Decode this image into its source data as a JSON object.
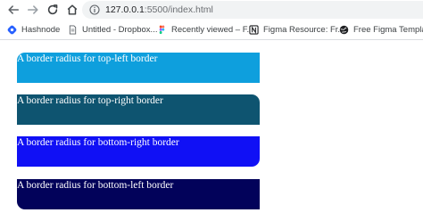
{
  "browser": {
    "url_host": "127.0.0.1",
    "url_rest": ":5500/index.html",
    "bookmarks": [
      {
        "label": "Hashnode",
        "icon": "hashnode-icon"
      },
      {
        "label": "Untitled - Dropbox...",
        "icon": "document-icon"
      },
      {
        "label": "Recently viewed – F...",
        "icon": "figma-icon"
      },
      {
        "label": "Figma Resource: Fr...",
        "icon": "notion-icon"
      },
      {
        "label": "Free Figma Templat...",
        "icon": "globe-icon"
      }
    ]
  },
  "page": {
    "boxes": [
      {
        "text": "A border radius for top-left border",
        "color": "#0e9fdd"
      },
      {
        "text": "A border radius for top-right border",
        "color": "#0e5470"
      },
      {
        "text": "A border radius for bottom-right border",
        "color": "#1010f5"
      },
      {
        "text": "A border radius for bottom-left border",
        "color": "#02025a"
      }
    ]
  }
}
